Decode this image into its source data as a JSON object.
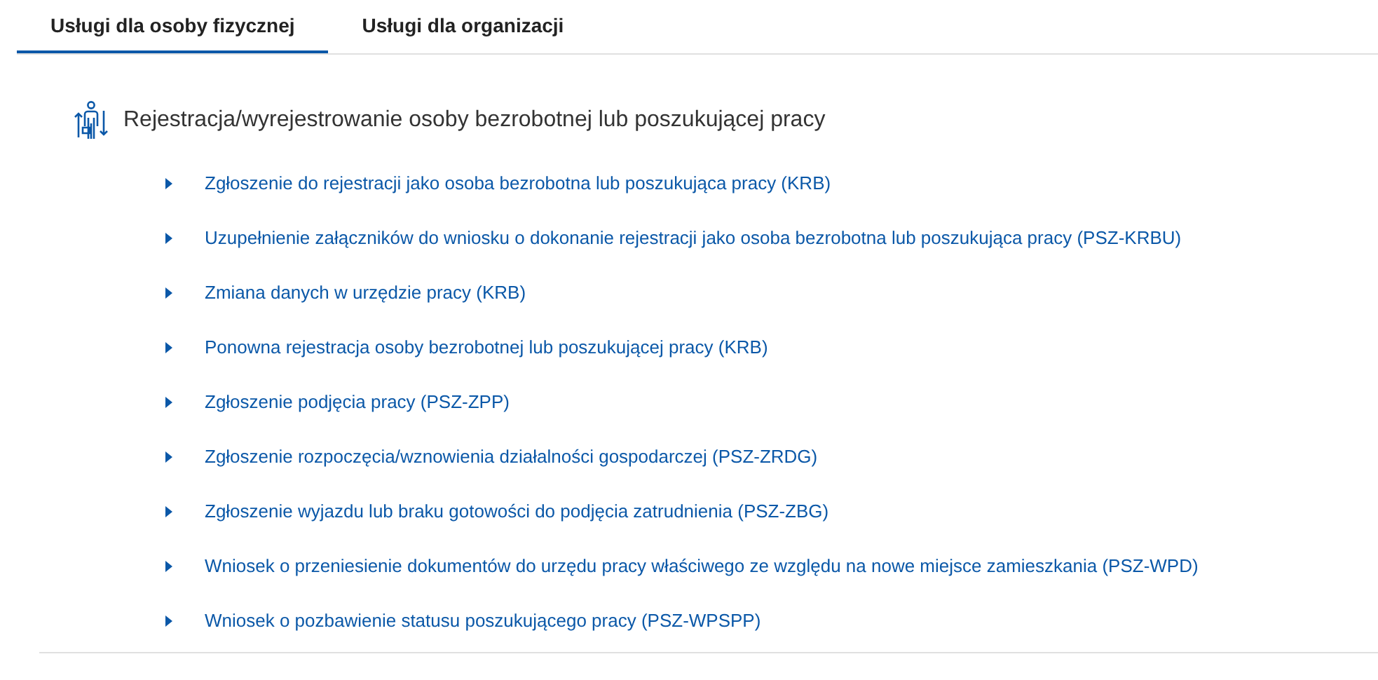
{
  "tabs": [
    {
      "label": "Usługi dla osoby fizycznej",
      "selected": true
    },
    {
      "label": "Usługi dla organizacji",
      "selected": false
    }
  ],
  "section": {
    "title": "Rejestracja/wyrejestrowanie osoby bezrobotnej lub poszukującej pracy",
    "links": [
      "Zgłoszenie do rejestracji jako osoba bezrobotna lub poszukująca pracy (KRB)",
      "Uzupełnienie załączników do wniosku o dokonanie rejestracji jako osoba bezrobotna lub poszukująca pracy (PSZ-KRBU)",
      "Zmiana danych w urzędzie pracy (KRB)",
      "Ponowna rejestracja osoby bezrobotnej lub poszukującej pracy (KRB)",
      "Zgłoszenie podjęcia pracy (PSZ-ZPP)",
      "Zgłoszenie rozpoczęcia/wznowienia działalności gospodarczej (PSZ-ZRDG)",
      "Zgłoszenie wyjazdu lub braku gotowości do podjęcia zatrudnienia (PSZ-ZBG)",
      "Wniosek o przeniesienie dokumentów do urzędu pracy właściwego ze względu na nowe miejsce zamieszkania (PSZ-WPD)",
      "Wniosek o pozbawienie statusu poszukującego pracy (PSZ-WPSPP)"
    ]
  }
}
